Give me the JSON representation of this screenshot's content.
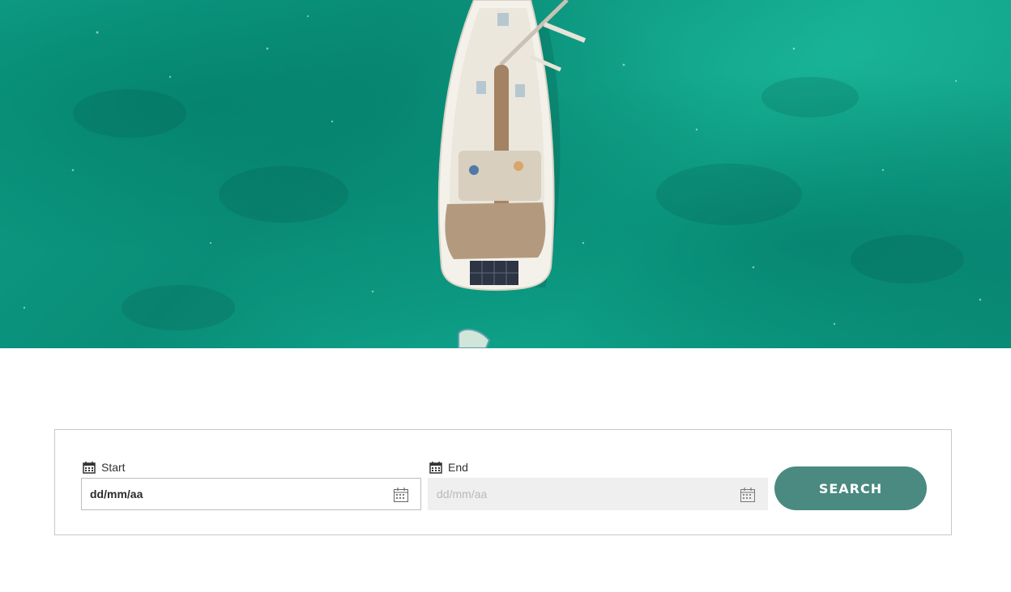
{
  "hero": {
    "image": "aerial-sailboat-turquoise-water"
  },
  "search_form": {
    "start": {
      "label": "Start",
      "value": "dd/mm/aa",
      "icon": "calendar-icon"
    },
    "end": {
      "label": "End",
      "placeholder": "dd/mm/aa",
      "icon": "calendar-icon"
    },
    "search_label": "SEARCH"
  },
  "colors": {
    "accent": "#4a8a80",
    "sea": "#0e9e86",
    "panel_border": "#c8c8c8",
    "disabled_input": "#efefef"
  }
}
